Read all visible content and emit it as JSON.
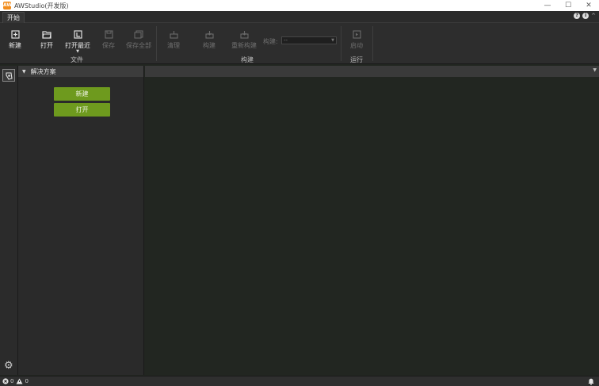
{
  "window": {
    "title": "AWStudio(开发版)",
    "logo_text": "AW",
    "minimize": "—",
    "maximize": "☐",
    "close": "✕"
  },
  "ribbon_tabs": [
    {
      "label": "开始",
      "selected": true
    }
  ],
  "ribbon": {
    "file_group": {
      "label": "文件",
      "buttons": [
        {
          "label": "新建",
          "icon": "new-file-icon",
          "enabled": true
        },
        {
          "label": "打开",
          "icon": "open-folder-icon",
          "enabled": true
        },
        {
          "label": "打开最近",
          "icon": "open-recent-icon",
          "enabled": true,
          "has_dropdown": true
        },
        {
          "label": "保存",
          "icon": "save-icon",
          "enabled": false
        },
        {
          "label": "保存全部",
          "icon": "save-all-icon",
          "enabled": false
        }
      ]
    },
    "build_group": {
      "label": "构建",
      "buttons": [
        {
          "label": "清理",
          "icon": "clean-icon",
          "enabled": false
        },
        {
          "label": "构建",
          "icon": "build-icon",
          "enabled": false
        },
        {
          "label": "重新构建",
          "icon": "rebuild-icon",
          "enabled": false
        }
      ],
      "config_label": "构建:",
      "config_value": "--"
    },
    "run_group": {
      "label": "运行",
      "buttons": [
        {
          "label": "启动",
          "icon": "start-icon",
          "enabled": false
        }
      ]
    }
  },
  "solution_panel": {
    "title": "解决方案",
    "new_button": "新建",
    "open_button": "打开"
  },
  "status_bar": {
    "errors": "0",
    "warnings": "0"
  },
  "colors": {
    "accent_green": "#6e9a1e",
    "editor_bg": "#222621",
    "logo_orange": "#f28c1b"
  }
}
